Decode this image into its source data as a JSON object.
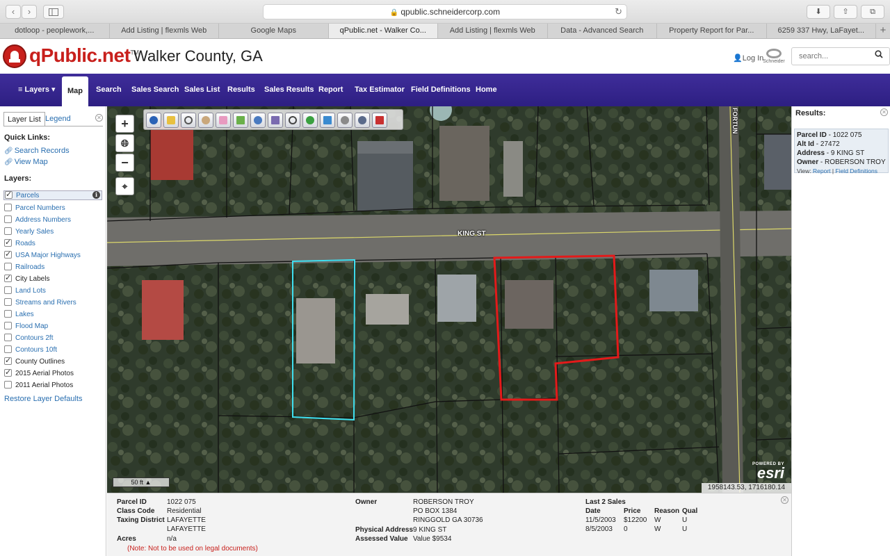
{
  "browser": {
    "url": "qpublic.schneidercorp.com",
    "back_icon": "chevron-left-icon",
    "forward_icon": "chevron-right-icon",
    "tabs": [
      {
        "label": "dotloop - peoplework,..."
      },
      {
        "label": "Add Listing | flexmls Web"
      },
      {
        "label": "Google Maps"
      },
      {
        "label": "qPublic.net - Walker Co..."
      },
      {
        "label": "Add Listing | flexmls Web"
      },
      {
        "label": "Data - Advanced Search"
      },
      {
        "label": "Property Report for Par..."
      },
      {
        "label": "6259 337 Hwy, LaFayet..."
      }
    ],
    "new_tab": "+"
  },
  "header": {
    "logo": "qPublic.net",
    "logo_tm": "TM",
    "county": "Walker County, GA",
    "login": "Log In",
    "brand": "Schneider",
    "search_placeholder": "search..."
  },
  "nav": {
    "layers": "≡ Layers ▾",
    "items": [
      "Map",
      "Search",
      "Sales Search",
      "Sales List",
      "Results",
      "Sales Results",
      "Report",
      "Tax Estimator",
      "Field Definitions",
      "Home"
    ]
  },
  "sidebar": {
    "tab_layer_list": "Layer List",
    "tab_legend": "Legend",
    "quick_links_heading": "Quick Links:",
    "quick_links": [
      "Search Records",
      "View Map"
    ],
    "layers_heading": "Layers:",
    "layers": [
      {
        "label": "Parcels",
        "checked": true
      },
      {
        "label": "Parcel Numbers",
        "checked": false
      },
      {
        "label": "Address Numbers",
        "checked": false
      },
      {
        "label": "Yearly Sales",
        "checked": false
      },
      {
        "label": "Roads",
        "checked": true
      },
      {
        "label": "USA Major Highways",
        "checked": true
      },
      {
        "label": "Railroads",
        "checked": false
      },
      {
        "label": "City Labels",
        "checked": true
      },
      {
        "label": "Land Lots",
        "checked": false
      },
      {
        "label": "Streams and Rivers",
        "checked": false
      },
      {
        "label": "Lakes",
        "checked": false
      },
      {
        "label": "Flood Map",
        "checked": false
      },
      {
        "label": "Contours 2ft",
        "checked": false
      },
      {
        "label": "Contours 10ft",
        "checked": false
      },
      {
        "label": "County Outlines",
        "checked": true
      },
      {
        "label": "2015 Aerial Photos",
        "checked": true
      },
      {
        "label": "2011 Aerial Photos",
        "checked": false
      }
    ],
    "restore": "Restore Layer Defaults"
  },
  "map": {
    "street_king": "KING ST",
    "street_fortune": "FORTUN",
    "scale": "50 ft",
    "coords": "1958143.53, 1716180.14",
    "powered_by": "POWERED BY",
    "esri": "esri"
  },
  "results": {
    "heading": "Results:",
    "parcel_id_label": "Parcel ID",
    "parcel_id": "1022 075",
    "alt_id_label": "Alt Id",
    "alt_id": "27472",
    "address_label": "Address",
    "address": "9 KING ST",
    "owner_label": "Owner",
    "owner": "ROBERSON TROY",
    "view_label": "View:",
    "report_link": "Report",
    "sep": "|",
    "field_defs_link": "Field Definitions"
  },
  "info": {
    "parcel_id_label": "Parcel ID",
    "parcel_id": "1022 075",
    "class_code_label": "Class Code",
    "class_code": "Residential",
    "taxing_district_label": "Taxing District",
    "taxing_district_1": "LAFAYETTE",
    "taxing_district_2": "LAFAYETTE",
    "acres_label": "Acres",
    "acres": "n/a",
    "note": "(Note: Not to be used on legal documents)",
    "owner_label": "Owner",
    "owner_1": "ROBERSON TROY",
    "owner_2": "PO BOX 1384",
    "owner_3": "RINGGOLD GA 30736",
    "physical_address_label": "Physical Address",
    "physical_address": "9 KING ST",
    "assessed_value_label": "Assessed Value",
    "assessed_value": "Value $9534",
    "sales_heading": "Last 2 Sales",
    "sales_cols": [
      "Date",
      "Price",
      "Reason",
      "Qual"
    ],
    "sales": [
      {
        "date": "11/5/2003",
        "price": "$12200",
        "reason": "W",
        "qual": "U"
      },
      {
        "date": "8/5/2003",
        "price": "0",
        "reason": "W",
        "qual": "U"
      }
    ]
  }
}
